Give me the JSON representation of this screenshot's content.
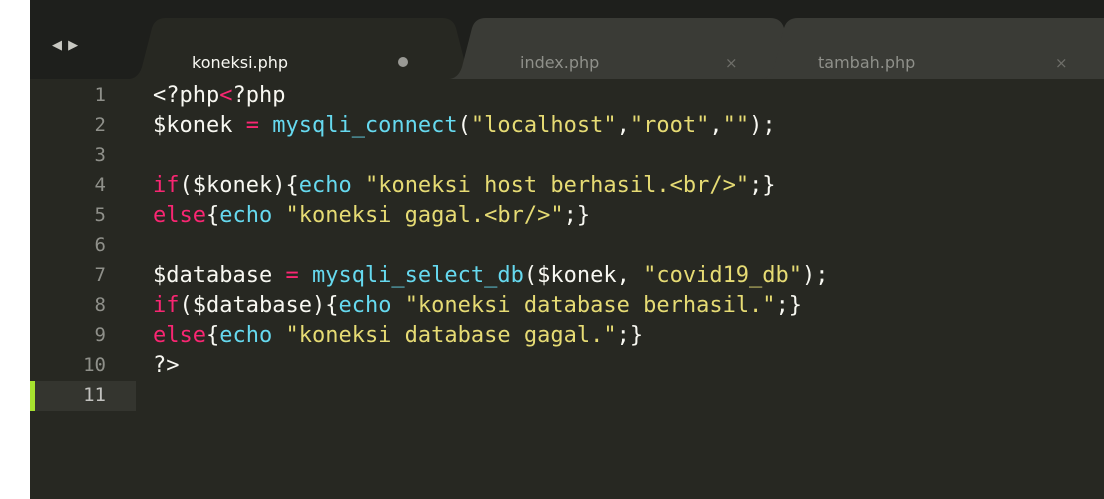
{
  "editor": {
    "nav_arrows": "◀ ▶",
    "tabs": [
      {
        "label": "koneksi.php",
        "state": "modified",
        "active": true
      },
      {
        "label": "index.php",
        "state": "close",
        "close_glyph": "×",
        "active": false
      },
      {
        "label": "tambah.php",
        "state": "close",
        "close_glyph": "×",
        "active": false
      }
    ],
    "current_line": 11,
    "lines": [
      {
        "num": "1",
        "tokens": [
          {
            "t": "<?php",
            "c": "plain"
          },
          {
            "t": "<",
            "c": "kw"
          },
          {
            "t": "?php",
            "c": "plain"
          }
        ]
      },
      {
        "num": "2",
        "tokens": [
          {
            "t": "$konek ",
            "c": "plain"
          },
          {
            "t": "=",
            "c": "kw"
          },
          {
            "t": " ",
            "c": "plain"
          },
          {
            "t": "mysqli_connect",
            "c": "fn"
          },
          {
            "t": "(",
            "c": "plain"
          },
          {
            "t": "\"localhost\"",
            "c": "str"
          },
          {
            "t": ",",
            "c": "plain"
          },
          {
            "t": "\"root\"",
            "c": "str"
          },
          {
            "t": ",",
            "c": "plain"
          },
          {
            "t": "\"\"",
            "c": "str"
          },
          {
            "t": ");",
            "c": "plain"
          }
        ]
      },
      {
        "num": "3",
        "tokens": []
      },
      {
        "num": "4",
        "tokens": [
          {
            "t": "if",
            "c": "kw"
          },
          {
            "t": "($konek){",
            "c": "plain"
          },
          {
            "t": "echo",
            "c": "fn"
          },
          {
            "t": " ",
            "c": "plain"
          },
          {
            "t": "\"koneksi host berhasil.<br/>\"",
            "c": "str"
          },
          {
            "t": ";}",
            "c": "plain"
          }
        ]
      },
      {
        "num": "5",
        "tokens": [
          {
            "t": "else",
            "c": "kw"
          },
          {
            "t": "{",
            "c": "plain"
          },
          {
            "t": "echo",
            "c": "fn"
          },
          {
            "t": " ",
            "c": "plain"
          },
          {
            "t": "\"koneksi gagal.<br/>\"",
            "c": "str"
          },
          {
            "t": ";}",
            "c": "plain"
          }
        ]
      },
      {
        "num": "6",
        "tokens": []
      },
      {
        "num": "7",
        "tokens": [
          {
            "t": "$database ",
            "c": "plain"
          },
          {
            "t": "=",
            "c": "kw"
          },
          {
            "t": " ",
            "c": "plain"
          },
          {
            "t": "mysqli_select_db",
            "c": "fn"
          },
          {
            "t": "($konek, ",
            "c": "plain"
          },
          {
            "t": "\"covid19_db\"",
            "c": "str"
          },
          {
            "t": ");",
            "c": "plain"
          }
        ]
      },
      {
        "num": "8",
        "tokens": [
          {
            "t": "if",
            "c": "kw"
          },
          {
            "t": "($database){",
            "c": "plain"
          },
          {
            "t": "echo",
            "c": "fn"
          },
          {
            "t": " ",
            "c": "plain"
          },
          {
            "t": "\"koneksi database berhasil.\"",
            "c": "str"
          },
          {
            "t": ";}",
            "c": "plain"
          }
        ]
      },
      {
        "num": "9",
        "tokens": [
          {
            "t": "else",
            "c": "kw"
          },
          {
            "t": "{",
            "c": "plain"
          },
          {
            "t": "echo",
            "c": "fn"
          },
          {
            "t": " ",
            "c": "plain"
          },
          {
            "t": "\"koneksi database gagal.\"",
            "c": "str"
          },
          {
            "t": ";}",
            "c": "plain"
          }
        ]
      },
      {
        "num": "10",
        "tokens": [
          {
            "t": "?>",
            "c": "plain"
          }
        ]
      },
      {
        "num": "11",
        "tokens": []
      }
    ]
  },
  "colors": {
    "background": "#272822",
    "tabbar": "#1e1f1c",
    "active_tab": "#272822",
    "inactive_tab": "#3a3b36",
    "keyword": "#f92672",
    "function": "#66d9ef",
    "string": "#e6db74",
    "text": "#f8f8f2",
    "current_line_marker": "#a6e22e"
  }
}
